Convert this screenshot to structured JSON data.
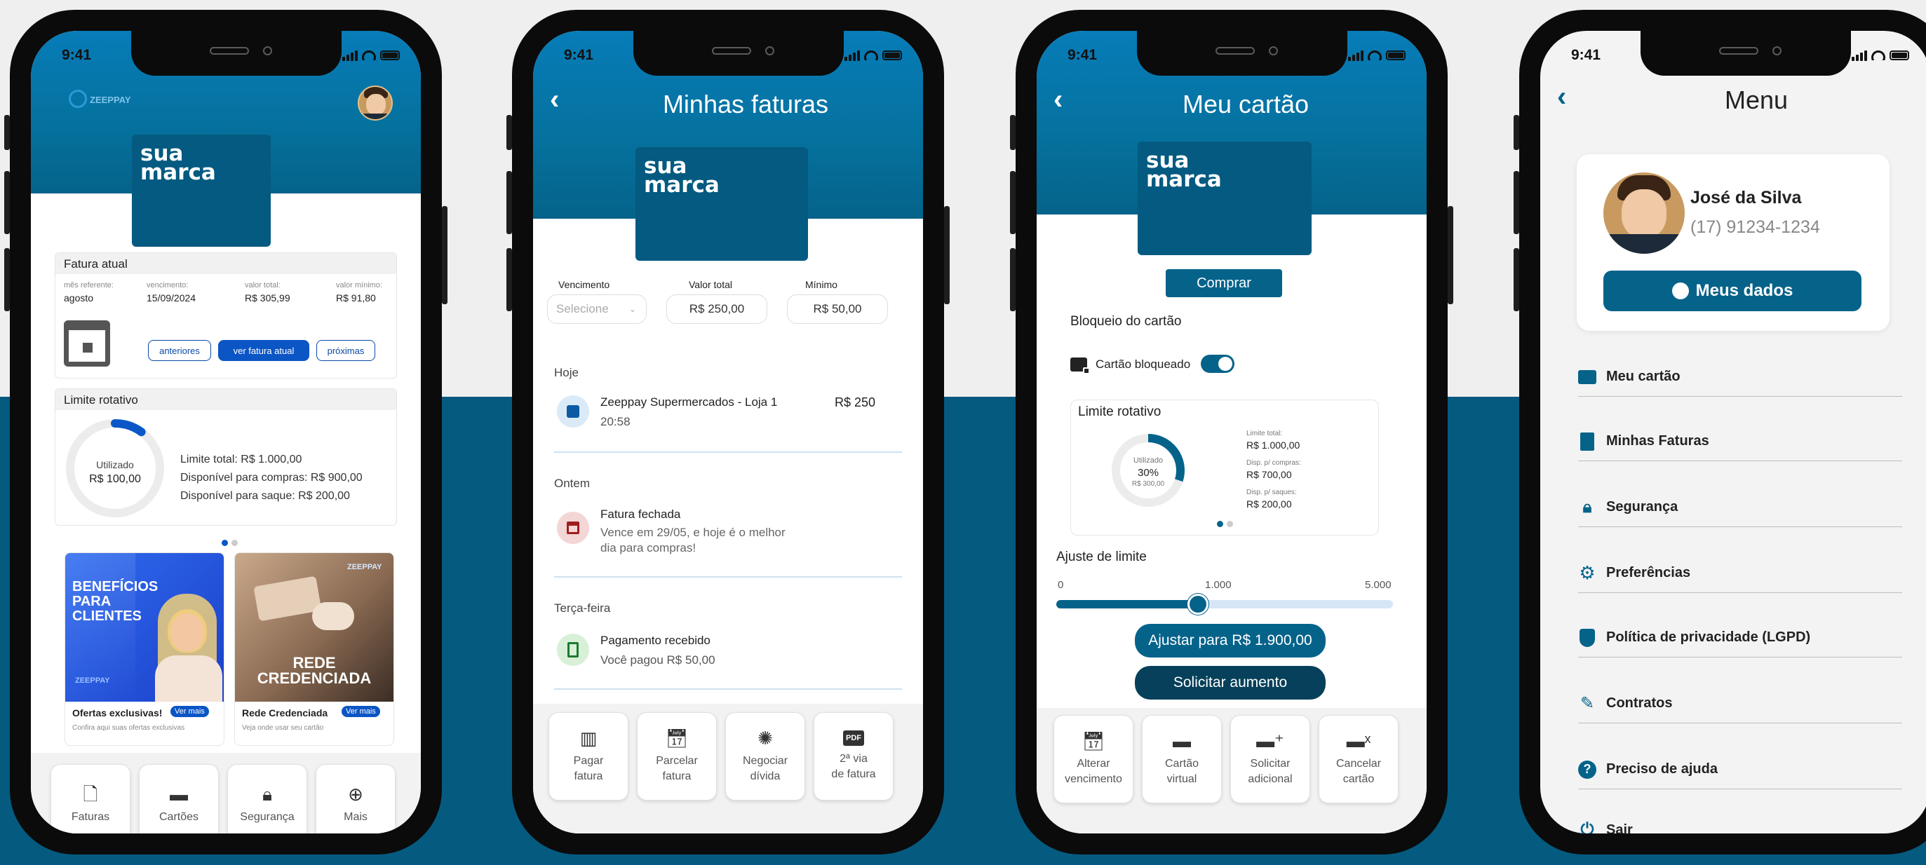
{
  "status_time": "9:41",
  "colors": {
    "primary": "#05638a",
    "accent_blue": "#0b55c5",
    "band": "#055a80"
  },
  "brand": {
    "line1": "sua",
    "line2": "marca",
    "logo": "ZEEPPAY"
  },
  "home": {
    "fatura": {
      "title": "Fatura atual",
      "mes_label": "mês referente:",
      "mes_value": "agosto",
      "venc_label": "vencimento:",
      "venc_value": "15/09/2024",
      "total_label": "valor total:",
      "total_value": "R$ 305,99",
      "min_label": "valor mínimo:",
      "min_value": "R$ 91,80",
      "btn_prev": "anteriores",
      "btn_current": "ver fatura atual",
      "btn_next": "próximas"
    },
    "limite": {
      "title": "Limite rotativo",
      "used_label": "Utilizado",
      "used_value": "R$ 100,00",
      "used_fraction": 0.1,
      "line1": "Limite total: R$ 1.000,00",
      "line2": "Disponível para compras: R$ 900,00",
      "line3": "Disponível para saque: R$ 200,00"
    },
    "promo1": {
      "img_text": "BENEFÍCIOS PARA CLIENTES",
      "logo": "ZEEPPAY",
      "title": "Ofertas exclusivas!",
      "badge": "Ver mais",
      "sub": "Confira aqui suas ofertas exclusivas"
    },
    "promo2": {
      "img_text1": "REDE",
      "img_text2": "CREDENCIADA",
      "logo": "ZEEPPAY",
      "title": "Rede Credenciada",
      "badge": "Ver mais",
      "sub": "Veja onde usar seu cartão"
    },
    "nav": [
      "Faturas",
      "Cartões",
      "Segurança",
      "Mais"
    ]
  },
  "faturas": {
    "title": "Minhas faturas",
    "venc_label": "Vencimento",
    "venc_placeholder": "Selecione",
    "total_label": "Valor total",
    "total_value": "R$ 250,00",
    "min_label": "Mínimo",
    "min_value": "R$ 50,00",
    "groups": [
      {
        "day": "Hoje",
        "title": "Zeeppay Supermercados - Loja 1",
        "sub": "20:58",
        "amount": "R$ 250"
      },
      {
        "day": "Ontem",
        "title": "Fatura fechada",
        "sub": "Vence em 29/05, e hoje é o melhor",
        "sub2": "dia para compras!"
      },
      {
        "day": "Terça-feira",
        "title": "Pagamento recebido",
        "sub": "Você pagou R$ 50,00"
      }
    ],
    "actions": [
      {
        "l1": "Pagar",
        "l2": "fatura"
      },
      {
        "l1": "Parcelar",
        "l2": "fatura"
      },
      {
        "l1": "Negociar",
        "l2": "dívida"
      },
      {
        "l1": "2ª via",
        "l2": "de fatura",
        "icon": "PDF"
      }
    ]
  },
  "cartao": {
    "title": "Meu cartão",
    "buy": "Comprar",
    "block_title": "Bloqueio do cartão",
    "block_label": "Cartão bloqueado",
    "limite_title": "Limite rotativo",
    "used_label": "Utilizado",
    "used_pct": "30%",
    "used_value": "R$ 300,00",
    "used_fraction": 0.3,
    "lt_label": "Limite total:",
    "lt_value": "R$ 1.000,00",
    "dc_label": "Disp. p/ compras:",
    "dc_value": "R$ 700,00",
    "ds_label": "Disp. p/ saques:",
    "ds_value": "R$ 200,00",
    "ajuste_title": "Ajuste de limite",
    "min": "0",
    "mid": "1.000",
    "max": "5.000",
    "slider_fraction": 0.42,
    "btn_ajustar": "Ajustar para R$ 1.900,00",
    "btn_aumento": "Solicitar aumento",
    "actions": [
      {
        "l1": "Alterar",
        "l2": "vencimento"
      },
      {
        "l1": "Cartão",
        "l2": "virtual"
      },
      {
        "l1": "Solicitar",
        "l2": "adicional"
      },
      {
        "l1": "Cancelar",
        "l2": "cartão"
      }
    ]
  },
  "menu": {
    "title": "Menu",
    "name": "José da Silva",
    "phone": "(17) 91234-1234",
    "btn": "Meus dados",
    "items": [
      "Meu cartão",
      "Minhas Faturas",
      "Segurança",
      "Preferências",
      "Política de privacidade (LGPD)",
      "Contratos",
      "Preciso de ajuda",
      "Sair"
    ]
  }
}
